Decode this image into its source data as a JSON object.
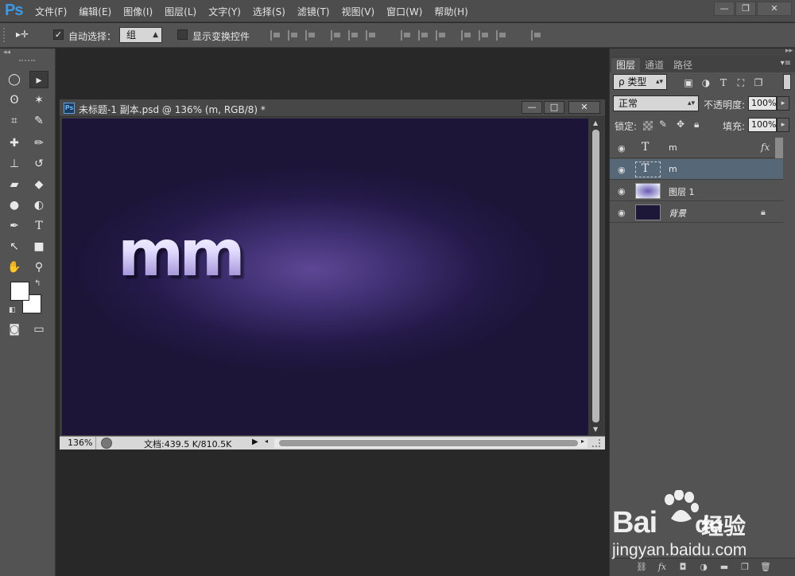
{
  "app": {
    "logo": "Ps",
    "menus": [
      "文件(F)",
      "编辑(E)",
      "图像(I)",
      "图层(L)",
      "文字(Y)",
      "选择(S)",
      "滤镜(T)",
      "视图(V)",
      "窗口(W)",
      "帮助(H)"
    ],
    "window_controls": {
      "minimize": "—",
      "restore": "❐",
      "close": "✕"
    }
  },
  "options_bar": {
    "move_tool_glyph": "▸✛",
    "auto_select_label": "自动选择：",
    "auto_select_checked": true,
    "auto_select_mode": "组",
    "show_transform_label": "显示变换控件",
    "show_transform_checked": false
  },
  "document": {
    "title": "未标题-1 副本.psd @ 136% (m, RGB/8) *",
    "canvas_text": "mm",
    "zoom": "136%",
    "doc_info": "文档:439.5 K/810.5K",
    "controls": {
      "minimize": "—",
      "restore": "□",
      "close": "✕"
    }
  },
  "panel": {
    "tabs": [
      "图层",
      "通道",
      "路径"
    ],
    "active_tab": "图层",
    "filter_kind": "ρ 类型",
    "blend_mode": "正常",
    "opacity_label": "不透明度:",
    "opacity_value": "100%",
    "lock_label": "锁定:",
    "fill_label": "填充:",
    "fill_value": "100%",
    "layers": [
      {
        "name": "m",
        "kind": "text",
        "fx": "fx",
        "selected": false
      },
      {
        "name": "m",
        "kind": "text",
        "selected": true
      },
      {
        "name": "图层 1",
        "kind": "pixel",
        "selected": false
      },
      {
        "name": "背景",
        "kind": "background",
        "locked": true,
        "selected": false
      }
    ]
  },
  "watermark": {
    "brand": "Bai",
    "brand_suffix": "du",
    "jingyan": "经验",
    "url": "jingyan.baidu.com"
  }
}
